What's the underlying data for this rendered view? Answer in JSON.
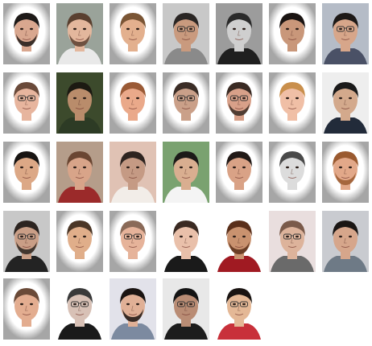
{
  "grid": {
    "columns": 7,
    "rows": 5,
    "photo_count": 33
  },
  "portraits": [
    {
      "bg": "#ffffff",
      "skin": "#d9a78f",
      "hair": "#1e1a18",
      "shirt": "#ffffff",
      "glasses": false,
      "beard": true,
      "vignette": true
    },
    {
      "bg": "#9aa39a",
      "skin": "#e3b79d",
      "hair": "#5a4030",
      "shirt": "#e9e9e9",
      "glasses": false,
      "beard": true,
      "vignette": false
    },
    {
      "bg": "#ffffff",
      "skin": "#e3b08e",
      "hair": "#7a5535",
      "shirt": "#ffffff",
      "glasses": false,
      "beard": false,
      "vignette": true
    },
    {
      "bg": "#c8c8c8",
      "skin": "#c99a7e",
      "hair": "#2a2624",
      "shirt": "#8a8a8a",
      "glasses": true,
      "beard": false,
      "vignette": false
    },
    {
      "bg": "#9c9c9c",
      "skin": "#cfcfcf",
      "hair": "#2a2a2a",
      "shirt": "#1f1f1f",
      "glasses": false,
      "beard": false,
      "vignette": false
    },
    {
      "bg": "#ffffff",
      "skin": "#c9977a",
      "hair": "#1a1412",
      "shirt": "#ffffff",
      "glasses": false,
      "beard": false,
      "vignette": true
    },
    {
      "bg": "#b5bcc7",
      "skin": "#d7a68a",
      "hair": "#1d1917",
      "shirt": "#4a5166",
      "glasses": true,
      "beard": false,
      "vignette": false
    },
    {
      "bg": "#ffffff",
      "skin": "#e7b59e",
      "hair": "#6a4a3a",
      "shirt": "#ffffff",
      "glasses": true,
      "beard": false,
      "vignette": true
    },
    {
      "bg": "#3c4a2c",
      "skin": "#b98c6b",
      "hair": "#1c1a12",
      "shirt": "#2d3b25",
      "glasses": false,
      "beard": false,
      "vignette": false
    },
    {
      "bg": "#ffffff",
      "skin": "#eaa98a",
      "hair": "#9a5a36",
      "shirt": "#ffffff",
      "glasses": false,
      "beard": false,
      "vignette": true
    },
    {
      "bg": "#ffffff",
      "skin": "#caa089",
      "hair": "#3b2d26",
      "shirt": "#ffffff",
      "glasses": true,
      "beard": false,
      "vignette": true
    },
    {
      "bg": "#ffffff",
      "skin": "#d8a089",
      "hair": "#3a2b24",
      "shirt": "#ffffff",
      "glasses": true,
      "beard": true,
      "vignette": true
    },
    {
      "bg": "#ffffff",
      "skin": "#f0bfa6",
      "hair": "#c98f4c",
      "shirt": "#ffffff",
      "glasses": false,
      "beard": false,
      "vignette": true
    },
    {
      "bg": "#eeeeee",
      "skin": "#d3a98c",
      "hair": "#1a1a1a",
      "shirt": "#222b3a",
      "glasses": false,
      "beard": false,
      "vignette": false
    },
    {
      "bg": "#ffffff",
      "skin": "#dca886",
      "hair": "#181412",
      "shirt": "#ffffff",
      "glasses": false,
      "beard": false,
      "vignette": true
    },
    {
      "bg": "#b59d8a",
      "skin": "#d8a489",
      "hair": "#6a4632",
      "shirt": "#9b2a2a",
      "glasses": false,
      "beard": false,
      "vignette": false
    },
    {
      "bg": "#e0c2b4",
      "skin": "#c59a84",
      "hair": "#2e2420",
      "shirt": "#f2ede8",
      "glasses": false,
      "beard": false,
      "vignette": false
    },
    {
      "bg": "#7aa270",
      "skin": "#d9ae90",
      "hair": "#1c1a18",
      "shirt": "#f4f4f4",
      "glasses": false,
      "beard": false,
      "vignette": false
    },
    {
      "bg": "#ffffff",
      "skin": "#d9a286",
      "hair": "#221a17",
      "shirt": "#ffffff",
      "glasses": false,
      "beard": false,
      "vignette": true
    },
    {
      "bg": "#ffffff",
      "skin": "#dcdcdc",
      "hair": "#4a4a4a",
      "shirt": "#ffffff",
      "glasses": false,
      "beard": false,
      "vignette": true
    },
    {
      "bg": "#ffffff",
      "skin": "#e2a889",
      "hair": "#9a5a30",
      "shirt": "#ffffff",
      "glasses": false,
      "beard": true,
      "vignette": true
    },
    {
      "bg": "#c8c8c8",
      "skin": "#c99e86",
      "hair": "#2c2420",
      "shirt": "#232323",
      "glasses": true,
      "beard": true,
      "vignette": false
    },
    {
      "bg": "#ffffff",
      "skin": "#e0ae8a",
      "hair": "#4b3626",
      "shirt": "#ffffff",
      "glasses": false,
      "beard": false,
      "vignette": true
    },
    {
      "bg": "#ffffff",
      "skin": "#e6b39a",
      "hair": "#8a6a58",
      "shirt": "#ffffff",
      "glasses": true,
      "beard": false,
      "vignette": true
    },
    {
      "bg": "#ffffff",
      "skin": "#e9c0aa",
      "hair": "#3a2a22",
      "shirt": "#1a1a1a",
      "glasses": false,
      "beard": false,
      "vignette": false
    },
    {
      "bg": "#ffffff",
      "skin": "#c9926f",
      "hair": "#5a2f1a",
      "shirt": "#a01a22",
      "glasses": false,
      "beard": true,
      "vignette": false
    },
    {
      "bg": "#e9dede",
      "skin": "#ddb39b",
      "hair": "#7a5a4a",
      "shirt": "#6a6a6a",
      "glasses": true,
      "beard": false,
      "vignette": false
    },
    {
      "bg": "#c9cbd0",
      "skin": "#d6a68b",
      "hair": "#1a1614",
      "shirt": "#6e7a86",
      "glasses": false,
      "beard": false,
      "vignette": false
    },
    {
      "bg": "#ffffff",
      "skin": "#e3ad90",
      "hair": "#6a4a38",
      "shirt": "#ffffff",
      "glasses": false,
      "beard": false,
      "vignette": true
    },
    {
      "bg": "#ffffff",
      "skin": "#d8c1b6",
      "hair": "#3a3a3a",
      "shirt": "#1a1a1a",
      "glasses": true,
      "beard": false,
      "vignette": false
    },
    {
      "bg": "#e2e2ea",
      "skin": "#e0b096",
      "hair": "#1a1412",
      "shirt": "#7c8aa0",
      "glasses": false,
      "beard": true,
      "vignette": false
    },
    {
      "bg": "#e8e8e8",
      "skin": "#b98c74",
      "hair": "#141414",
      "shirt": "#1c1c1c",
      "glasses": true,
      "beard": false,
      "vignette": false
    },
    {
      "bg": "#ffffff",
      "skin": "#e4b896",
      "hair": "#1a1412",
      "shirt": "#c8303a",
      "glasses": true,
      "beard": false,
      "vignette": false
    }
  ]
}
